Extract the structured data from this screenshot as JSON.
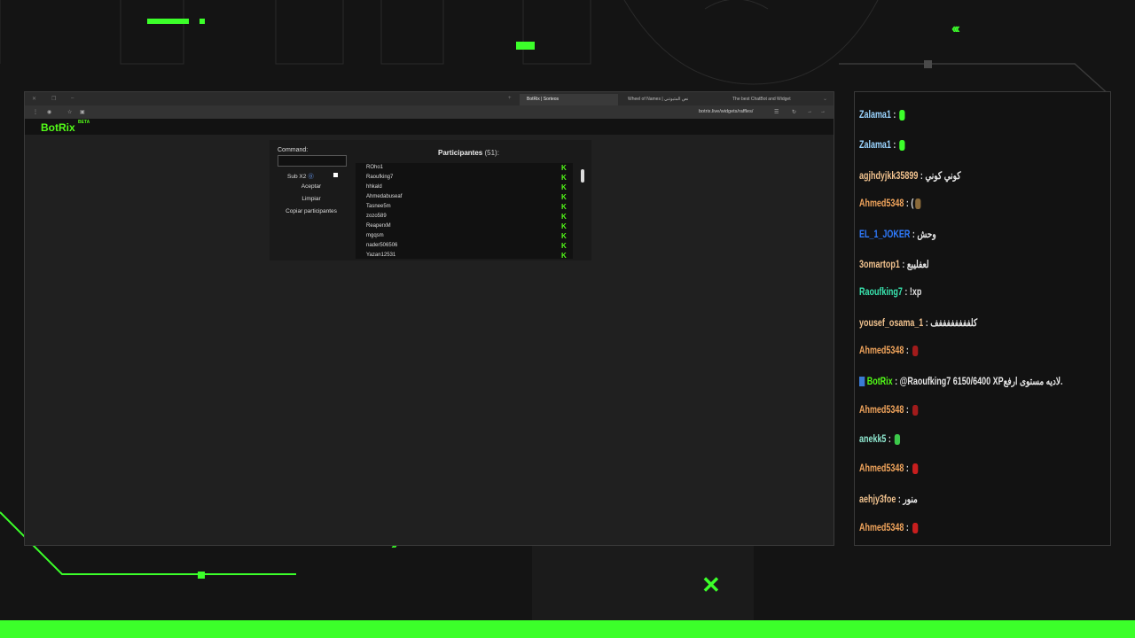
{
  "browser": {
    "tabs": [
      {
        "label": "BotRix | Sorteos"
      },
      {
        "label": "Wheel of Names | نص المثبوتني"
      },
      {
        "label": "The best ChatBot and Widget"
      }
    ],
    "url": "botrix.live/widgets/raffles/"
  },
  "brand": {
    "logo": "BotRix",
    "badge": "BETA"
  },
  "raffle": {
    "command_label": "Command:",
    "command_value": "",
    "sub_label": "Sub X2",
    "accept": "Aceptar",
    "clear": "Limpiar",
    "copy": "Copiar participantes",
    "participants_title": "Participantes",
    "participants_count": "(51):",
    "participants": [
      "ROho1",
      "Raoufking7",
      "hhkald",
      "Ahmedabuseaf",
      "Tasnee5m",
      "zozo589",
      "ReaperxM",
      "mgqsm",
      "nader506506",
      "Yazan12531"
    ],
    "platform_glyph": "K"
  },
  "chat": {
    "messages": [
      {
        "user": "Zalama1",
        "color": "#9ad4ff",
        "sep": ":",
        "text": "",
        "emote": "#3cff2a"
      },
      {
        "user": "Zalama1",
        "color": "#9ad4ff",
        "sep": ":",
        "text": "",
        "emote": "#3cff2a"
      },
      {
        "user": "agjhdyjkk35899",
        "color": "#f2c38f",
        "sep": ":",
        "text": "كوني كوني",
        "emote": ""
      },
      {
        "user": "Ahmed5348",
        "color": "#f2a55c",
        "sep": ":",
        "text": "(",
        "emote": "#8a6a3a"
      },
      {
        "user": "EL_1_JOKER",
        "color": "#2f7bff",
        "sep": ":",
        "text": "وحش",
        "emote": ""
      },
      {
        "user": "3omartop1",
        "color": "#f2c38f",
        "sep": ":",
        "text": "لعفليبع",
        "emote": ""
      },
      {
        "user": "Raoufking7",
        "color": "#39e6b0",
        "sep": ":",
        "text": "!xp",
        "emote": ""
      },
      {
        "user": "yousef_osama_1",
        "color": "#f2c38f",
        "sep": ":",
        "text": "كلففففففففف",
        "emote": ""
      },
      {
        "user": "Ahmed5348",
        "color": "#f2a55c",
        "sep": ":",
        "text": "",
        "emote": "#a21b1b"
      },
      {
        "user": "BotRix",
        "color": "#53fc18",
        "sep": ":",
        "text": "@Raoufking7 6150/6400 XPلاديه مستوى ارفع.",
        "emote": ""
      },
      {
        "user": "Ahmed5348",
        "color": "#f2a55c",
        "sep": ":",
        "text": "",
        "emote": "#a21b1b"
      },
      {
        "user": "anekk5",
        "color": "#8fe8d0",
        "sep": ":",
        "text": "",
        "emote": "#3cc84a"
      },
      {
        "user": "Ahmed5348",
        "color": "#f2a55c",
        "sep": ":",
        "text": "",
        "emote": "#c81e1e"
      },
      {
        "user": "aehjy3foe",
        "color": "#f2c38f",
        "sep": ":",
        "text": "منور",
        "emote": ""
      },
      {
        "user": "Ahmed5348",
        "color": "#f2a55c",
        "sep": ":",
        "text": "",
        "emote": "#c81e1e"
      }
    ]
  },
  "colors": {
    "accent": "#3cff2a",
    "kick": "#53fc18"
  }
}
